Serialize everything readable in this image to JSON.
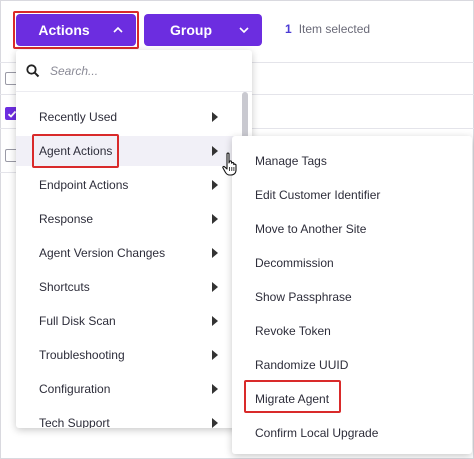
{
  "toolbar": {
    "actions_label": "Actions",
    "group_label": "Group",
    "selected_count": "1",
    "selected_text": "Item selected"
  },
  "menu": {
    "search_placeholder": "Search...",
    "items": [
      {
        "label": "Recently Used"
      },
      {
        "label": "Agent Actions"
      },
      {
        "label": "Endpoint Actions"
      },
      {
        "label": "Response"
      },
      {
        "label": "Agent Version Changes"
      },
      {
        "label": "Shortcuts"
      },
      {
        "label": "Full Disk Scan"
      },
      {
        "label": "Troubleshooting"
      },
      {
        "label": "Configuration"
      },
      {
        "label": "Tech Support"
      }
    ]
  },
  "submenu": {
    "items": [
      {
        "label": "Manage Tags"
      },
      {
        "label": "Edit Customer Identifier"
      },
      {
        "label": "Move to Another Site"
      },
      {
        "label": "Decommission"
      },
      {
        "label": "Show Passphrase"
      },
      {
        "label": "Revoke Token"
      },
      {
        "label": "Randomize UUID"
      },
      {
        "label": "Migrate Agent"
      },
      {
        "label": "Confirm Local Upgrade"
      }
    ]
  },
  "colors": {
    "accent": "#6c2de0",
    "highlight_outline": "#d92a2a",
    "count_text": "#4b3bd4"
  },
  "icons": [
    "chevron-up-icon",
    "chevron-down-icon",
    "search-icon",
    "caret-right-icon",
    "hand-pointer-icon",
    "checkmark-icon"
  ]
}
